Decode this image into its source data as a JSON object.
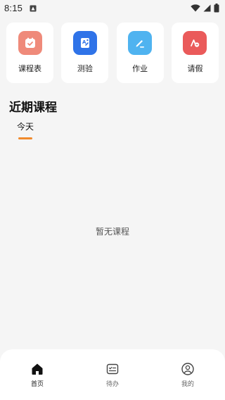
{
  "status_bar": {
    "time": "8:15"
  },
  "quick_actions": [
    {
      "label": "课程表",
      "icon": "schedule-icon",
      "color": "#ef8a7a"
    },
    {
      "label": "测验",
      "icon": "quiz-icon",
      "color": "#2f73e8"
    },
    {
      "label": "作业",
      "icon": "homework-icon",
      "color": "#4fb3f0"
    },
    {
      "label": "请假",
      "icon": "leave-icon",
      "color": "#ea5a5a"
    }
  ],
  "section": {
    "title": "近期课程",
    "tabs": [
      {
        "label": "今天",
        "active": true
      }
    ],
    "accent_color": "#f08a2c",
    "empty_text": "暂无课程"
  },
  "bottom_nav": [
    {
      "label": "首页",
      "icon": "home-icon",
      "active": true
    },
    {
      "label": "待办",
      "icon": "todo-icon",
      "active": false
    },
    {
      "label": "我的",
      "icon": "profile-icon",
      "active": false
    }
  ]
}
